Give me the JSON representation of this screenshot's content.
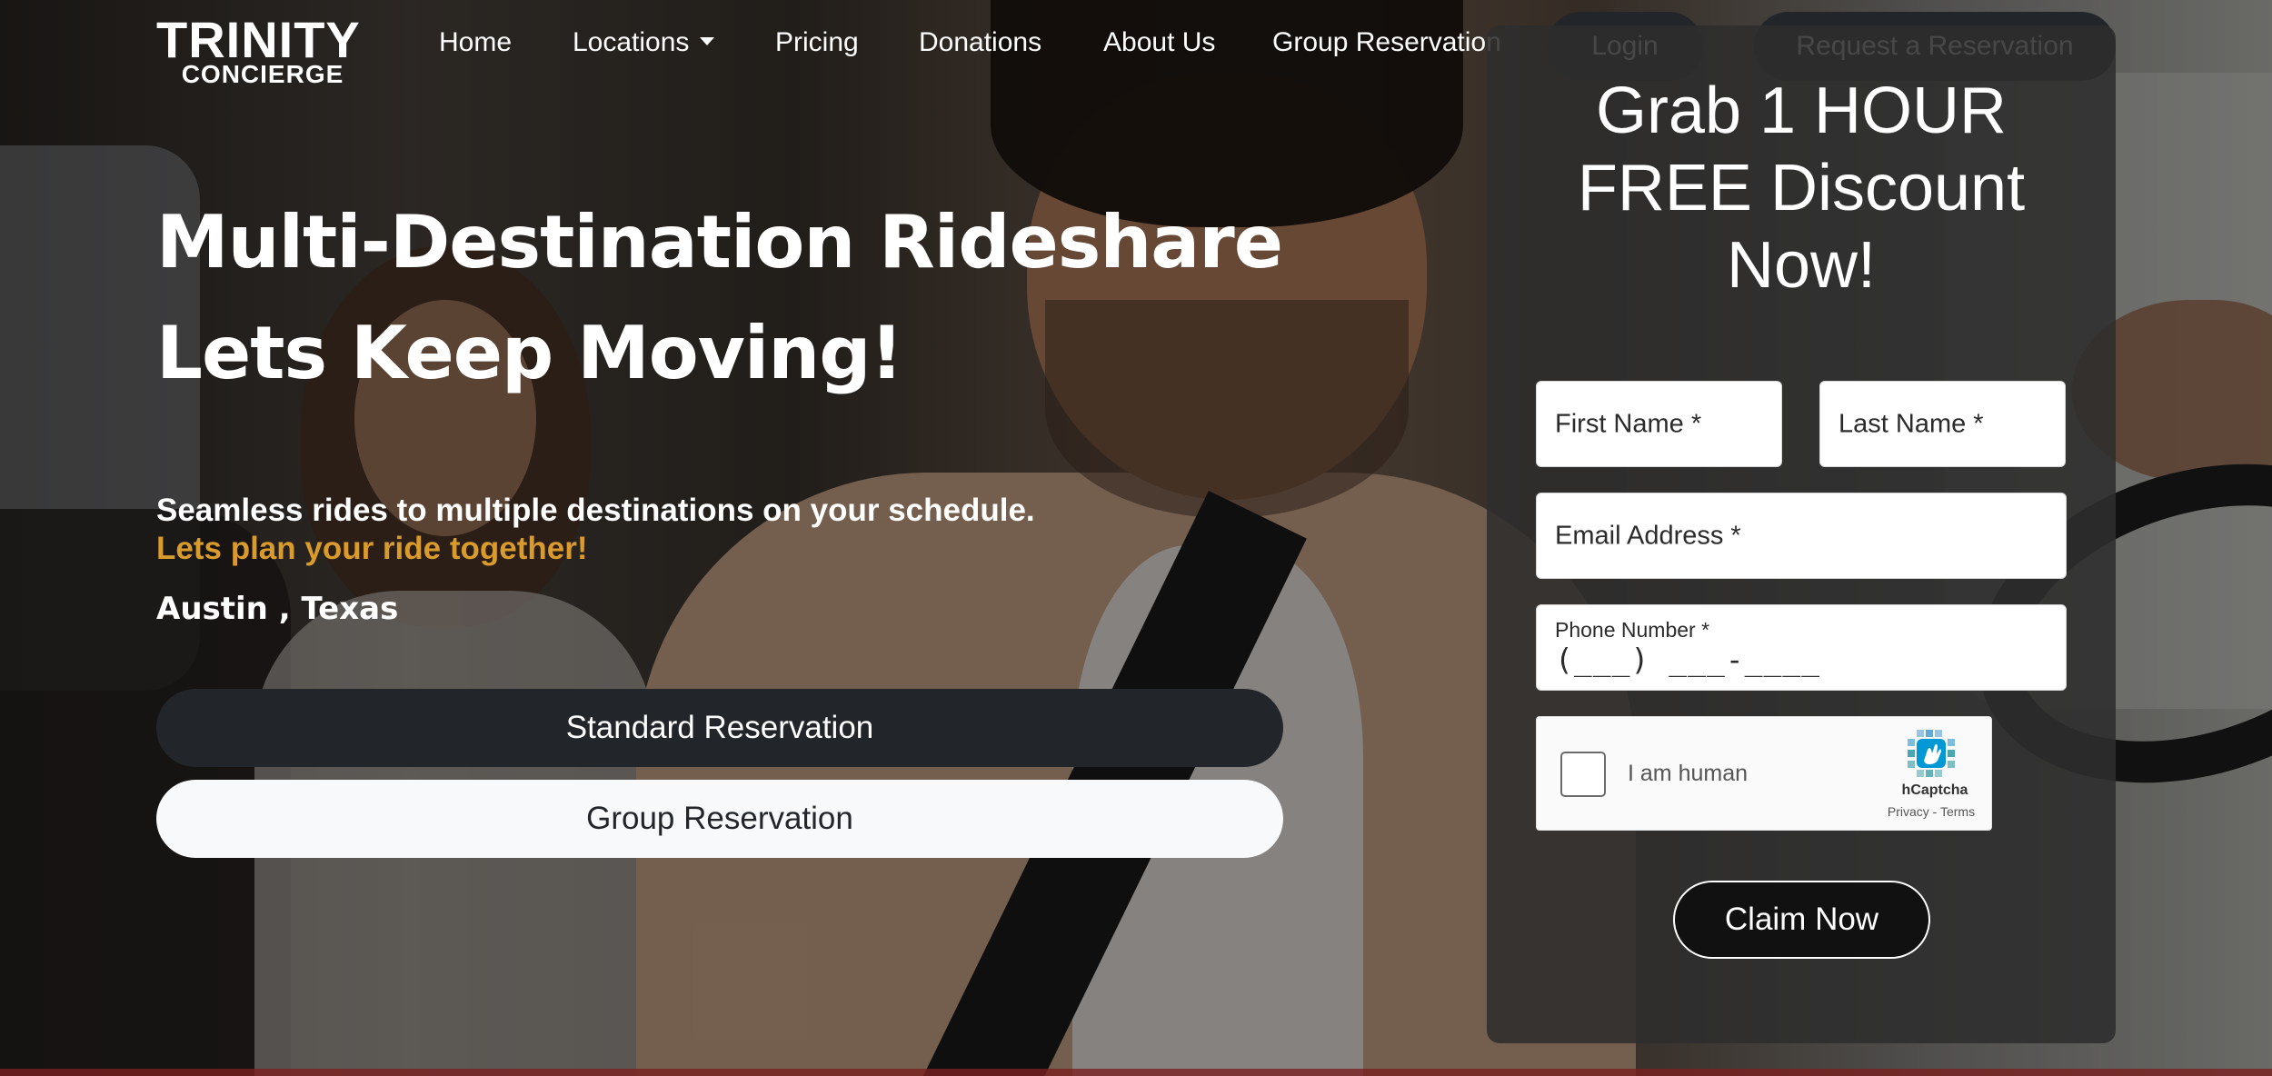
{
  "nav": {
    "logo_top": "TRINITY",
    "logo_bottom": "CONCIERGE",
    "items": [
      {
        "label": "Home"
      },
      {
        "label": "Locations"
      },
      {
        "label": "Pricing"
      },
      {
        "label": "Donations"
      },
      {
        "label": "About Us"
      },
      {
        "label": "Group Reservation"
      }
    ],
    "login_label": "Login",
    "request_label": "Request a Reservation"
  },
  "hero": {
    "title_line1": "Multi-Destination Rideshare",
    "title_line2": "Lets Keep Moving!",
    "subtitle": "Seamless rides to multiple destinations on your schedule.",
    "accent": "Lets plan your ride together!",
    "location": "Austin , Texas",
    "btn_standard": "Standard Reservation",
    "btn_group": "Group Reservation"
  },
  "form": {
    "title_line1": "Grab 1 HOUR",
    "title_line2": "FREE Discount",
    "title_line3": "Now!",
    "first_name": "First Name *",
    "last_name": "Last Name *",
    "email": "Email Address *",
    "phone_label": "Phone Number *",
    "phone_mask": "(___) ___-____",
    "captcha_text": "I am human",
    "captcha_brand": "hCaptcha",
    "captcha_links": "Privacy - Terms",
    "submit": "Claim Now"
  },
  "colors": {
    "accent": "#d99b2b",
    "dark_button": "#22262b",
    "light_button": "#f8f9fa",
    "panel": "#2d2d2d"
  }
}
